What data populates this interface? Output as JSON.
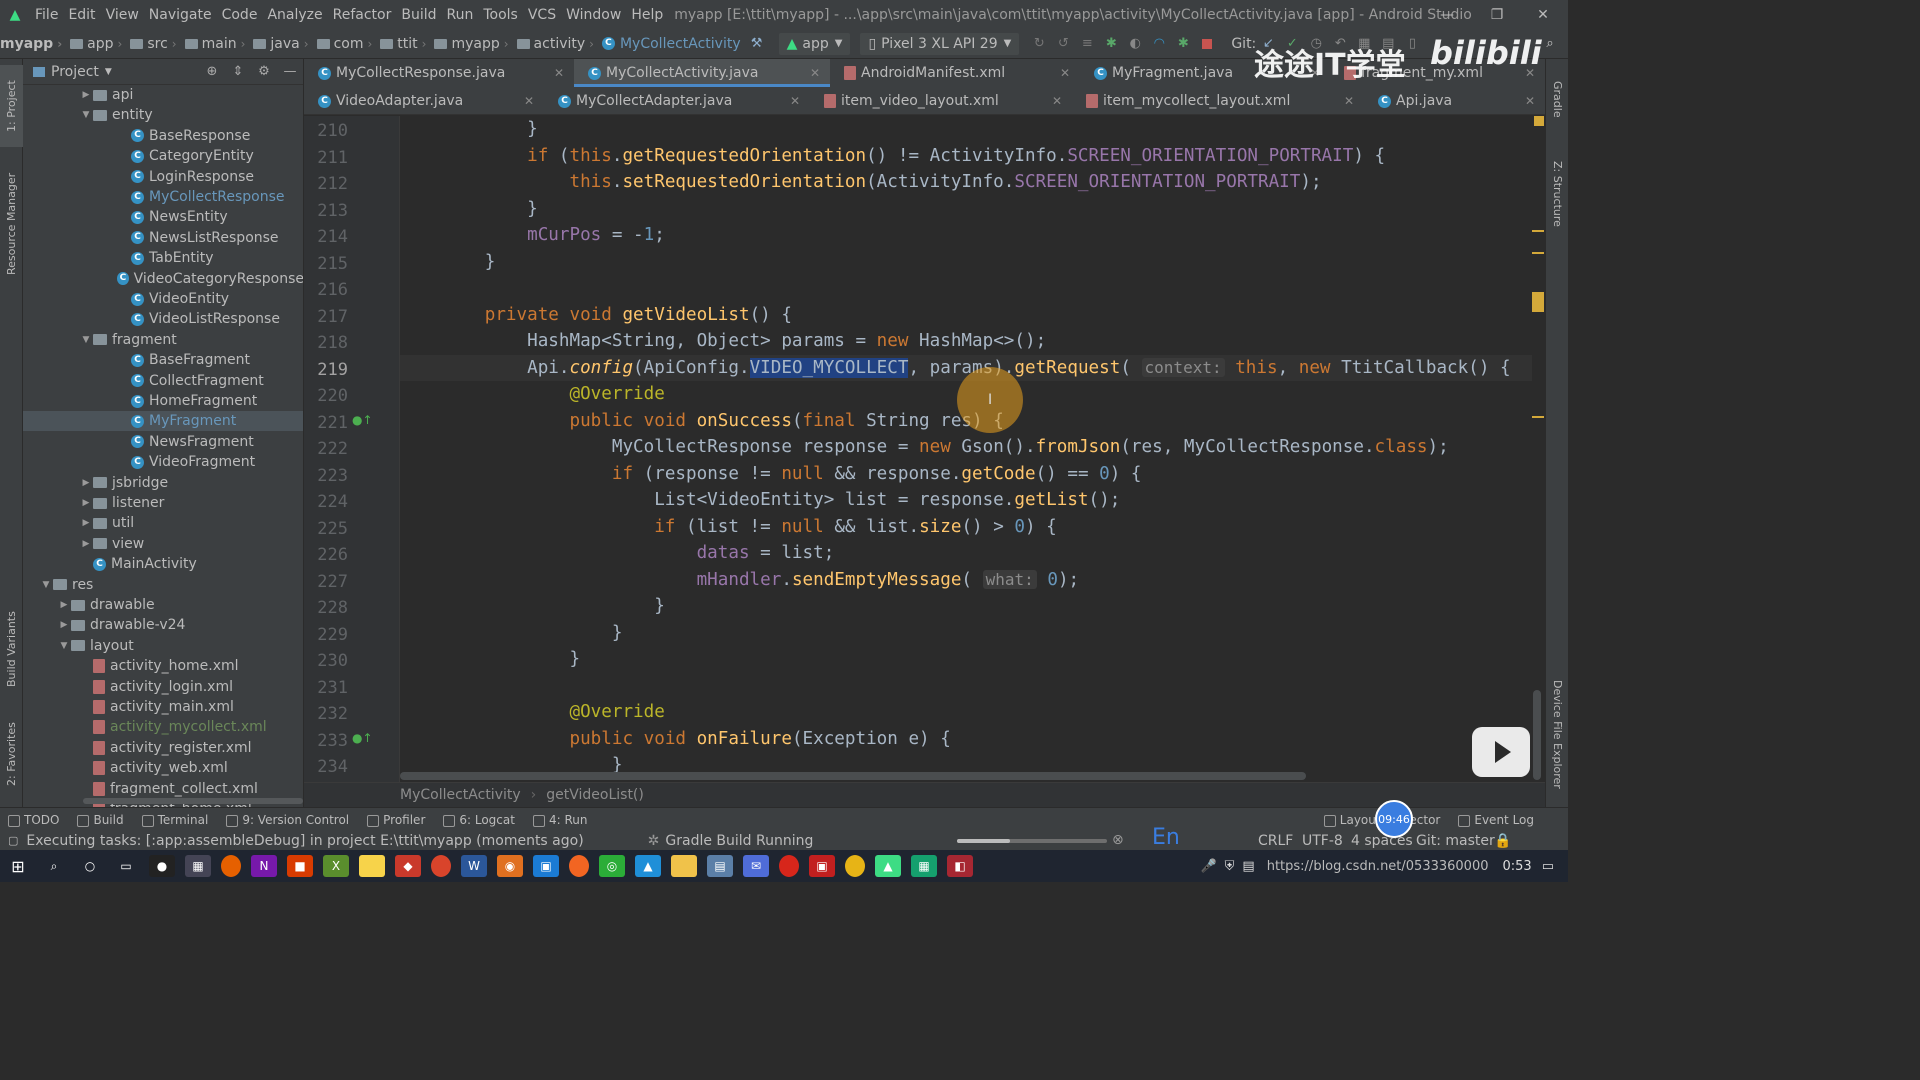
{
  "menubar": {
    "items": [
      "File",
      "Edit",
      "View",
      "Navigate",
      "Code",
      "Analyze",
      "Refactor",
      "Build",
      "Run",
      "Tools",
      "VCS",
      "Window",
      "Help"
    ],
    "window_title": "myapp [E:\\ttit\\myapp] - ...\\app\\src\\main\\java\\com\\ttit\\myapp\\activity\\MyCollectActivity.java [app] - Android Studio"
  },
  "navbar": {
    "crumbs": [
      "myapp",
      "app",
      "src",
      "main",
      "java",
      "com",
      "ttit",
      "myapp",
      "activity",
      "MyCollectActivity"
    ],
    "run_config": "app",
    "device": "Pixel 3 XL API 29",
    "git_label": "Git:"
  },
  "left_strip": {
    "tabs": [
      "1: Project",
      "Resource Manager",
      "Build Variants",
      "2: Favorites"
    ]
  },
  "right_strip": {
    "tabs": [
      "Gradle",
      "Z: Structure",
      "Device File Explorer"
    ]
  },
  "project_panel": {
    "title": "Project",
    "tree": [
      {
        "label": "api",
        "kind": "package",
        "level": 0,
        "arrow": "collapsed"
      },
      {
        "label": "entity",
        "kind": "package",
        "level": 0,
        "arrow": "expanded"
      },
      {
        "label": "BaseResponse",
        "kind": "class",
        "level": 1
      },
      {
        "label": "CategoryEntity",
        "kind": "class",
        "level": 1
      },
      {
        "label": "LoginResponse",
        "kind": "class",
        "level": 1
      },
      {
        "label": "MyCollectResponse",
        "kind": "class",
        "level": 1,
        "color": "blue"
      },
      {
        "label": "NewsEntity",
        "kind": "class",
        "level": 1
      },
      {
        "label": "NewsListResponse",
        "kind": "class",
        "level": 1
      },
      {
        "label": "TabEntity",
        "kind": "class",
        "level": 1
      },
      {
        "label": "VideoCategoryResponse",
        "kind": "class",
        "level": 1
      },
      {
        "label": "VideoEntity",
        "kind": "class",
        "level": 1
      },
      {
        "label": "VideoListResponse",
        "kind": "class",
        "level": 1
      },
      {
        "label": "fragment",
        "kind": "package",
        "level": 0,
        "arrow": "expanded"
      },
      {
        "label": "BaseFragment",
        "kind": "class",
        "level": 1
      },
      {
        "label": "CollectFragment",
        "kind": "class",
        "level": 1
      },
      {
        "label": "HomeFragment",
        "kind": "class",
        "level": 1
      },
      {
        "label": "MyFragment",
        "kind": "class",
        "level": 1,
        "color": "blue",
        "selected": true
      },
      {
        "label": "NewsFragment",
        "kind": "class",
        "level": 1
      },
      {
        "label": "VideoFragment",
        "kind": "class",
        "level": 1
      },
      {
        "label": "jsbridge",
        "kind": "package",
        "level": 0,
        "arrow": "collapsed"
      },
      {
        "label": "listener",
        "kind": "package",
        "level": 0,
        "arrow": "collapsed"
      },
      {
        "label": "util",
        "kind": "package",
        "level": 0,
        "arrow": "collapsed"
      },
      {
        "label": "view",
        "kind": "package",
        "level": 0,
        "arrow": "collapsed"
      },
      {
        "label": "MainActivity",
        "kind": "class",
        "level": 0
      },
      {
        "label": "res",
        "kind": "folder",
        "level": -2,
        "arrow": "expanded"
      },
      {
        "label": "drawable",
        "kind": "folder",
        "level": -1,
        "arrow": "collapsed"
      },
      {
        "label": "drawable-v24",
        "kind": "folder",
        "level": -1,
        "arrow": "collapsed"
      },
      {
        "label": "layout",
        "kind": "folder",
        "level": -1,
        "arrow": "expanded"
      },
      {
        "label": "activity_home.xml",
        "kind": "xml",
        "level": 0
      },
      {
        "label": "activity_login.xml",
        "kind": "xml",
        "level": 0
      },
      {
        "label": "activity_main.xml",
        "kind": "xml",
        "level": 0
      },
      {
        "label": "activity_mycollect.xml",
        "kind": "xml",
        "level": 0,
        "color": "green"
      },
      {
        "label": "activity_register.xml",
        "kind": "xml",
        "level": 0
      },
      {
        "label": "activity_web.xml",
        "kind": "xml",
        "level": 0
      },
      {
        "label": "fragment_collect.xml",
        "kind": "xml",
        "level": 0
      },
      {
        "label": "fragment_home.xml",
        "kind": "xml",
        "level": 0
      }
    ]
  },
  "editor_tabs": {
    "row1": [
      {
        "label": "MyCollectResponse.java",
        "icon": "class",
        "active": false
      },
      {
        "label": "MyCollectActivity.java",
        "icon": "class",
        "active": true
      },
      {
        "label": "AndroidManifest.xml",
        "icon": "xml",
        "active": false
      },
      {
        "label": "MyFragment.java",
        "icon": "class",
        "active": false
      },
      {
        "label": "fragment_my.xml",
        "icon": "xml",
        "active": false
      }
    ],
    "row2": [
      {
        "label": "VideoAdapter.java",
        "icon": "class",
        "active": false
      },
      {
        "label": "MyCollectAdapter.java",
        "icon": "class",
        "active": false
      },
      {
        "label": "item_video_layout.xml",
        "icon": "xml",
        "active": false
      },
      {
        "label": "item_mycollect_layout.xml",
        "icon": "xml",
        "active": false
      },
      {
        "label": "Api.java",
        "icon": "class",
        "active": false
      }
    ]
  },
  "editor": {
    "current_line": 219,
    "lines": [
      {
        "n": 210,
        "indent": 8,
        "tokens": [
          [
            "br",
            "}"
          ]
        ]
      },
      {
        "n": 211,
        "indent": 8,
        "tokens": [
          [
            "kw",
            "if "
          ],
          [
            "br",
            "("
          ],
          [
            "kw",
            "this"
          ],
          [
            "",
            "."
          ],
          [
            "fn",
            "getRequestedOrientation"
          ],
          [
            "",
            "() != ActivityInfo."
          ],
          [
            "fd",
            "SCREEN_ORIENTATION_PORTRAIT"
          ],
          [
            "",
            ") {"
          ]
        ]
      },
      {
        "n": 212,
        "indent": 12,
        "tokens": [
          [
            "kw",
            "this"
          ],
          [
            "",
            "."
          ],
          [
            "fn",
            "setRequestedOrientation"
          ],
          [
            "",
            "(ActivityInfo."
          ],
          [
            "fd",
            "SCREEN_ORIENTATION_PORTRAIT"
          ],
          [
            "",
            ");"
          ]
        ]
      },
      {
        "n": 213,
        "indent": 8,
        "tokens": [
          [
            "",
            "}"
          ]
        ]
      },
      {
        "n": 214,
        "indent": 8,
        "tokens": [
          [
            "fd",
            "mCurPos"
          ],
          [
            "",
            " = -"
          ],
          [
            "num",
            "1"
          ],
          [
            "",
            ";"
          ]
        ]
      },
      {
        "n": 215,
        "indent": 4,
        "tokens": [
          [
            "",
            "}"
          ]
        ]
      },
      {
        "n": 216,
        "indent": 0,
        "tokens": []
      },
      {
        "n": 217,
        "indent": 4,
        "tokens": [
          [
            "kw",
            "private void "
          ],
          [
            "fn",
            "getVideoList"
          ],
          [
            "",
            "() {"
          ]
        ]
      },
      {
        "n": 218,
        "indent": 8,
        "tokens": [
          [
            "",
            "HashMap<String, Object> params = "
          ],
          [
            "kw",
            "new "
          ],
          [
            "",
            "HashMap<>();"
          ]
        ]
      },
      {
        "n": 219,
        "indent": 8,
        "tokens": [
          [
            "",
            "Api."
          ],
          [
            "it",
            "config"
          ],
          [
            "",
            "(ApiConfig."
          ],
          [
            "sel",
            "VIDEO_MYCOLLECT"
          ],
          [
            "",
            ", params)."
          ],
          [
            "fn",
            "getRequest"
          ],
          [
            "",
            "( "
          ],
          [
            "hint",
            "context:"
          ],
          [
            "",
            " "
          ],
          [
            "kw",
            "this"
          ],
          [
            "",
            ", "
          ],
          [
            "kw",
            "new "
          ],
          [
            "",
            "TtitCallback() {"
          ]
        ]
      },
      {
        "n": 220,
        "indent": 12,
        "tokens": [
          [
            "an",
            "@Override"
          ]
        ]
      },
      {
        "n": 221,
        "indent": 12,
        "tokens": [
          [
            "kw",
            "public void "
          ],
          [
            "fn",
            "onSuccess"
          ],
          [
            "",
            "("
          ],
          [
            "kw",
            "final "
          ],
          [
            "",
            "String res) {"
          ]
        ]
      },
      {
        "n": 222,
        "indent": 16,
        "tokens": [
          [
            "",
            "MyCollectResponse response = "
          ],
          [
            "kw",
            "new "
          ],
          [
            "",
            "Gson()."
          ],
          [
            "fn",
            "fromJson"
          ],
          [
            "",
            "(res, MyCollectResponse."
          ],
          [
            "kw",
            "class"
          ],
          [
            "",
            ");"
          ]
        ]
      },
      {
        "n": 223,
        "indent": 16,
        "tokens": [
          [
            "kw",
            "if "
          ],
          [
            "",
            "(response != "
          ],
          [
            "kw",
            "null "
          ],
          [
            "",
            "&& response."
          ],
          [
            "fn",
            "getCode"
          ],
          [
            "",
            "() == "
          ],
          [
            "num",
            "0"
          ],
          [
            "",
            ") {"
          ]
        ]
      },
      {
        "n": 224,
        "indent": 20,
        "tokens": [
          [
            "",
            "List<VideoEntity> list = response."
          ],
          [
            "fn",
            "getList"
          ],
          [
            "",
            "();"
          ]
        ]
      },
      {
        "n": 225,
        "indent": 20,
        "tokens": [
          [
            "kw",
            "if "
          ],
          [
            "",
            "(list != "
          ],
          [
            "kw",
            "null "
          ],
          [
            "",
            "&& list."
          ],
          [
            "fn",
            "size"
          ],
          [
            "",
            "() > "
          ],
          [
            "num",
            "0"
          ],
          [
            "",
            ") {"
          ]
        ]
      },
      {
        "n": 226,
        "indent": 24,
        "tokens": [
          [
            "fd",
            "datas"
          ],
          [
            "",
            " = list;"
          ]
        ]
      },
      {
        "n": 227,
        "indent": 24,
        "tokens": [
          [
            "fd",
            "mHandler"
          ],
          [
            "",
            "."
          ],
          [
            "fn",
            "sendEmptyMessage"
          ],
          [
            "",
            "( "
          ],
          [
            "hint",
            "what:"
          ],
          [
            "",
            " "
          ],
          [
            "num",
            "0"
          ],
          [
            "",
            ");"
          ]
        ]
      },
      {
        "n": 228,
        "indent": 20,
        "tokens": [
          [
            "",
            "}"
          ]
        ]
      },
      {
        "n": 229,
        "indent": 16,
        "tokens": [
          [
            "",
            "}"
          ]
        ]
      },
      {
        "n": 230,
        "indent": 12,
        "tokens": [
          [
            "",
            "}"
          ]
        ]
      },
      {
        "n": 231,
        "indent": 0,
        "tokens": []
      },
      {
        "n": 232,
        "indent": 12,
        "tokens": [
          [
            "an",
            "@Override"
          ]
        ]
      },
      {
        "n": 233,
        "indent": 12,
        "tokens": [
          [
            "kw",
            "public void "
          ],
          [
            "fn",
            "onFailure"
          ],
          [
            "",
            "(Exception e) {"
          ]
        ]
      },
      {
        "n": 234,
        "indent": 16,
        "tokens": [
          [
            "",
            "}"
          ]
        ]
      }
    ],
    "breadcrumb": [
      "MyCollectActivity",
      "getVideoList()"
    ]
  },
  "bottom_tabs": [
    "TODO",
    "Build",
    "Terminal",
    "9: Version Control",
    "Profiler",
    "6: Logcat",
    "4: Run"
  ],
  "bottom_tabs_right": [
    "Layout Inspector",
    "Event Log"
  ],
  "statusbar": {
    "message": "Executing tasks: [:app:assembleDebug] in project E:\\ttit\\myapp (moments ago)",
    "build_status": "Gradle Build Running",
    "line_endings": "CRLF",
    "encoding": "UTF-8",
    "indent": "4 spaces",
    "vcs_branch": "Git: master",
    "ime": "En",
    "progress": 0.35
  },
  "overlays": {
    "watermark_text": "途途IT学堂",
    "bilibili_logo": "bilibili",
    "timer": "09:46",
    "bottom_url": "https://blog.csdn.net/0533360000"
  },
  "taskbar": {
    "clock": "0:53"
  }
}
